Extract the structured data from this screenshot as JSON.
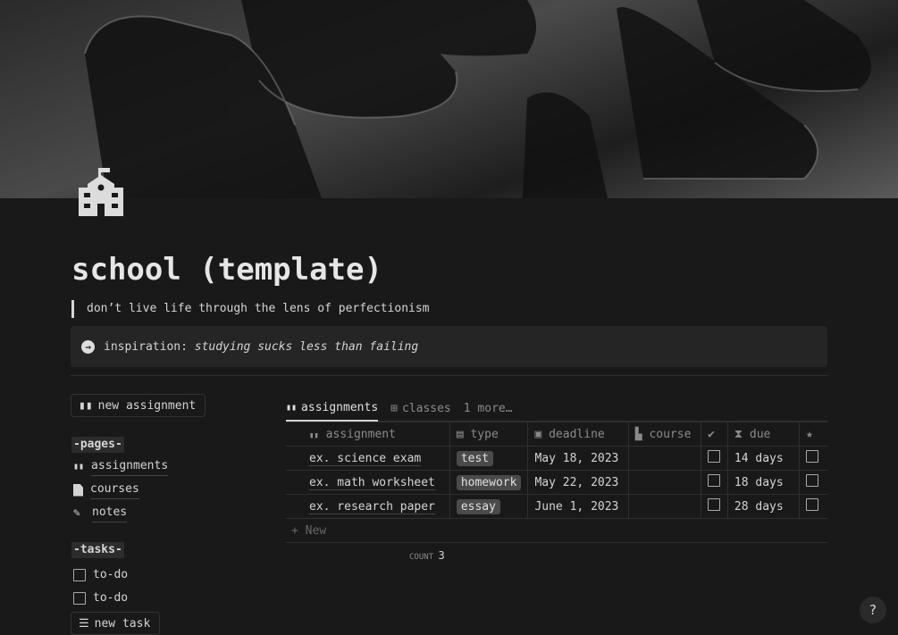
{
  "page": {
    "title": "school (template)",
    "quote": "don’t live life through the lens of perfectionism",
    "callout_prefix": "inspiration:",
    "callout_italic": "studying sucks less than failing"
  },
  "sidebar": {
    "new_assignment": "new assignment",
    "pages_heading": "-pages-",
    "pages": [
      "assignments",
      "courses",
      "notes"
    ],
    "tasks_heading": "-tasks-",
    "tasks": [
      "to-do",
      "to-do"
    ],
    "new_task": "new task"
  },
  "views": {
    "tabs": [
      "assignments",
      "classes",
      "1 more…"
    ]
  },
  "table": {
    "headers": [
      "assignment",
      "type",
      "deadline",
      "course",
      "",
      "due",
      ""
    ],
    "rows": [
      {
        "assignment": "ex. science exam",
        "type": "test",
        "deadline": "May 18, 2023",
        "course": "",
        "due": "14 days"
      },
      {
        "assignment": "ex. math worksheet",
        "type": "homework",
        "deadline": "May 22, 2023",
        "course": "",
        "due": "18 days"
      },
      {
        "assignment": "ex. research paper",
        "type": "essay",
        "deadline": "June 1, 2023",
        "course": "",
        "due": "28 days"
      }
    ],
    "new_label": "+ New",
    "count_label": "COUNT",
    "count_value": "3"
  },
  "help": "?"
}
